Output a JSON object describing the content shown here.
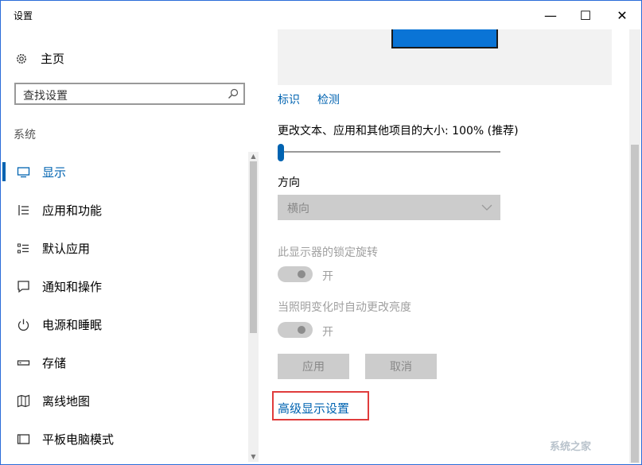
{
  "window": {
    "title": "设置"
  },
  "title_buttons": {
    "minimize": "—",
    "maximize": "☐",
    "close": "✕"
  },
  "sidebar": {
    "home_label": "主页",
    "search_placeholder": "查找设置",
    "section_title": "系统",
    "items": [
      {
        "label": "显示",
        "icon": "monitor-icon",
        "active": true
      },
      {
        "label": "应用和功能",
        "icon": "list-icon"
      },
      {
        "label": "默认应用",
        "icon": "default-apps-icon"
      },
      {
        "label": "通知和操作",
        "icon": "notification-icon"
      },
      {
        "label": "电源和睡眠",
        "icon": "power-icon"
      },
      {
        "label": "存储",
        "icon": "storage-icon"
      },
      {
        "label": "离线地图",
        "icon": "map-icon"
      },
      {
        "label": "平板电脑模式",
        "icon": "tablet-icon"
      }
    ]
  },
  "main": {
    "identify_link": "标识",
    "detect_link": "检测",
    "scale_label": "更改文本、应用和其他项目的大小: 100% (推荐)",
    "scale_level": 0,
    "orientation_label": "方向",
    "orientation_value": "横向",
    "rotation_lock_label": "此显示器的锁定旋转",
    "rotation_lock_state": "开",
    "auto_brightness_label": "当照明变化时自动更改亮度",
    "auto_brightness_state": "开",
    "apply_button": "应用",
    "cancel_button": "取消",
    "advanced_link": "高级显示设置"
  },
  "watermark": "系统之家",
  "colors": {
    "accent": "#0063b1",
    "highlight": "#e03c3c"
  }
}
